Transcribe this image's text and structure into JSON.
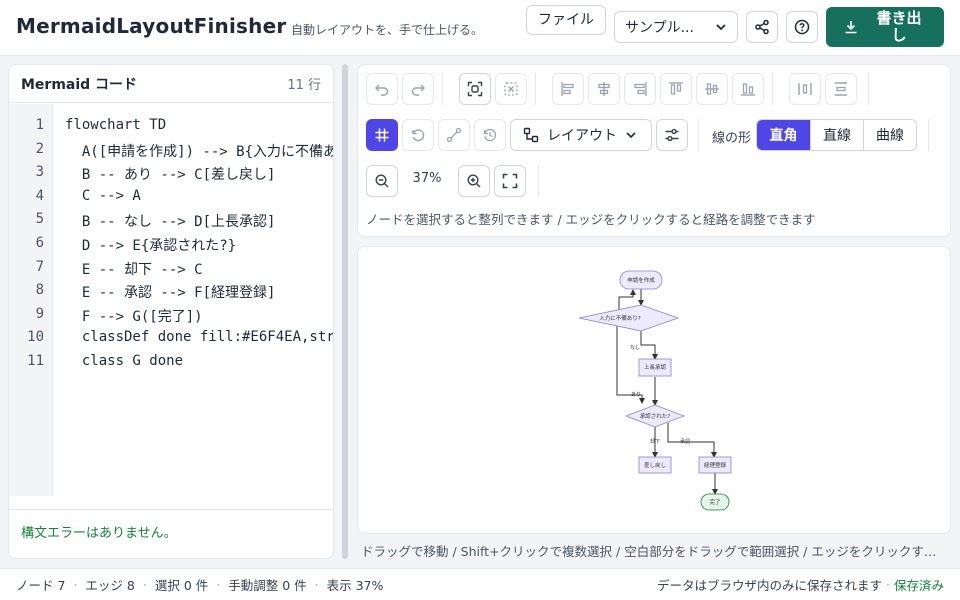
{
  "header": {
    "title": "MermaidLayoutFinisher",
    "subtitle": "自動レイアウトを、手で仕上げる。",
    "file_label": "ファイル",
    "sample_label": "サンプル...",
    "export_label": "書き出し"
  },
  "editor": {
    "title": "Mermaid コード",
    "line_count": "11 行",
    "lines": [
      {
        "n": "1",
        "text": "flowchart TD"
      },
      {
        "n": "2",
        "text": "  A([申請を作成]) --> B{入力に不備あ"
      },
      {
        "n": "3",
        "text": "  B -- あり --> C[差し戻し]"
      },
      {
        "n": "4",
        "text": "  C --> A"
      },
      {
        "n": "5",
        "text": "  B -- なし --> D[上長承認]"
      },
      {
        "n": "6",
        "text": "  D --> E{承認された?}"
      },
      {
        "n": "7",
        "text": "  E -- 却下 --> C"
      },
      {
        "n": "8",
        "text": "  E -- 承認 --> F[経理登録]"
      },
      {
        "n": "9",
        "text": "  F --> G([完了])"
      },
      {
        "n": "10",
        "text": "  classDef done fill:#E6F4EA,str"
      },
      {
        "n": "11",
        "text": "  class G done"
      }
    ],
    "status": "構文エラーはありません。"
  },
  "toolbar": {
    "layout_label": "レイアウト",
    "line_shape_label": "線の形",
    "line_shapes": [
      "直角",
      "直線",
      "曲線"
    ],
    "line_shape_selected": "直角",
    "zoom": "37%",
    "hint": "ノードを選択すると整列できます / エッジをクリックすると経路を調整できます"
  },
  "diagram": {
    "nodes": {
      "A": "申請を作成",
      "B": "入力に不備あり?",
      "C": "差し戻し",
      "D": "上長承認",
      "E": "承認された?",
      "F": "経理登録",
      "G": "完了"
    },
    "edge_labels": {
      "b_yes": "あり",
      "b_no": "なし",
      "e_reject": "却下",
      "e_approve": "承認"
    }
  },
  "canvas_help": "ドラッグで移動 / Shift+クリックで複数選択 / 空白部分をドラッグで範囲選択 / エッジをクリックすると経路を調整できます",
  "footer": {
    "nodes": "ノード 7",
    "edges": "エッジ 8",
    "selected": "選択 0 件",
    "manual": "手動調整 0 件",
    "zoom": "表示 37%",
    "storage": "データはブラウザ内のみに保存されます",
    "saved": "保存済み"
  },
  "colors": {
    "accent": "#4f46e5",
    "export": "#17705e",
    "ok": "#16803c",
    "node_fill": "#ede9fe",
    "node_stroke": "#8b7fd1",
    "done_fill": "#E6F4EA"
  }
}
